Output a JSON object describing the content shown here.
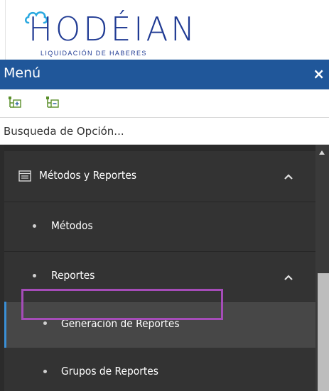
{
  "logo": {
    "wordmark": "HODÉIAN",
    "tagline": "LIQUIDACIÓN DE HABERES",
    "color": "#1f3a93",
    "cloud_color": "#29a8e0"
  },
  "menu": {
    "title": "Menú",
    "close_symbol": "×",
    "header_color": "#20579a"
  },
  "toolbar": {
    "expand_icon": "tree-expand-icon",
    "collapse_icon": "tree-collapse-icon"
  },
  "search": {
    "placeholder": "Busqueda de Opción...",
    "value": ""
  },
  "nav": {
    "items": [
      {
        "label": "Métodos y Reportes",
        "icon": "document-list-icon",
        "expanded": true
      },
      {
        "label": "Métodos"
      },
      {
        "label": "Reportes",
        "expanded": true
      },
      {
        "label": "Generación de Reportes",
        "active": true,
        "highlighted": true
      },
      {
        "label": "Grupos de Reportes"
      }
    ],
    "active_bar_color": "#3a8fd6",
    "highlight_color": "#a54cb8",
    "panel_color": "#333333"
  }
}
